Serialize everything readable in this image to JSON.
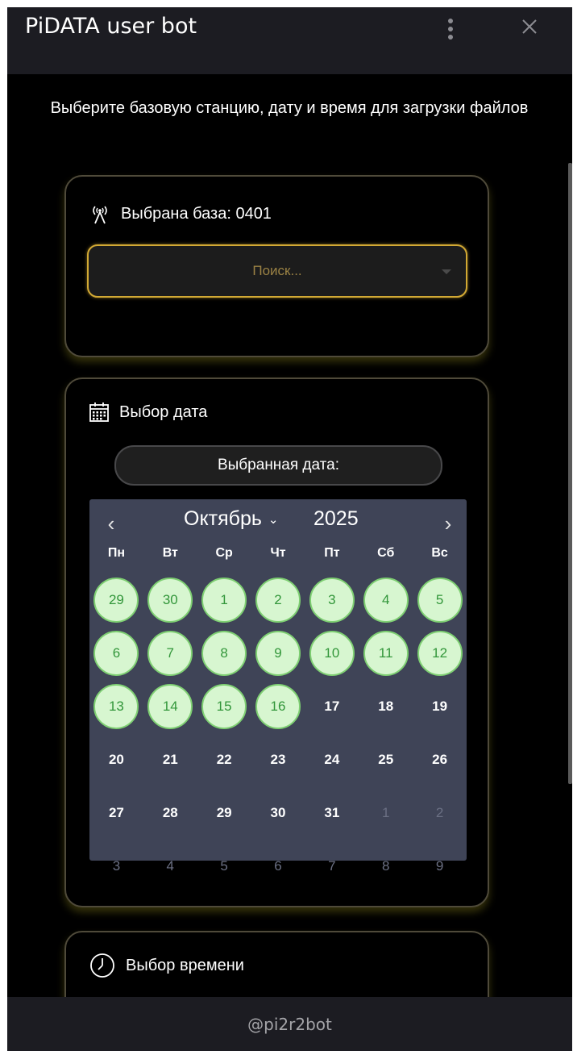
{
  "window": {
    "title": "PiDATA user bot"
  },
  "intro_text": "Выберите базовую станцию, дату и время для загрузки файлов",
  "base_card": {
    "heading": "Выбрана база: 0401",
    "search": {
      "placeholder": "Поиск..."
    }
  },
  "date_card": {
    "heading": "Выбор дата",
    "selected_date_label": "Выбранная дата:",
    "calendar": {
      "month": "Октябрь",
      "year": "2025",
      "weekdays": [
        "Пн",
        "Вт",
        "Ср",
        "Чт",
        "Пт",
        "Сб",
        "Вс"
      ],
      "days": [
        {
          "label": "29",
          "state": "available"
        },
        {
          "label": "30",
          "state": "available"
        },
        {
          "label": "1",
          "state": "available"
        },
        {
          "label": "2",
          "state": "available"
        },
        {
          "label": "3",
          "state": "available"
        },
        {
          "label": "4",
          "state": "available"
        },
        {
          "label": "5",
          "state": "available"
        },
        {
          "label": "6",
          "state": "available"
        },
        {
          "label": "7",
          "state": "available"
        },
        {
          "label": "8",
          "state": "available"
        },
        {
          "label": "9",
          "state": "available"
        },
        {
          "label": "10",
          "state": "available"
        },
        {
          "label": "11",
          "state": "available"
        },
        {
          "label": "12",
          "state": "available"
        },
        {
          "label": "13",
          "state": "available"
        },
        {
          "label": "14",
          "state": "available"
        },
        {
          "label": "15",
          "state": "available"
        },
        {
          "label": "16",
          "state": "available"
        },
        {
          "label": "17",
          "state": "normal"
        },
        {
          "label": "18",
          "state": "normal"
        },
        {
          "label": "19",
          "state": "normal"
        },
        {
          "label": "20",
          "state": "normal"
        },
        {
          "label": "21",
          "state": "normal"
        },
        {
          "label": "22",
          "state": "normal"
        },
        {
          "label": "23",
          "state": "normal"
        },
        {
          "label": "24",
          "state": "normal"
        },
        {
          "label": "25",
          "state": "normal"
        },
        {
          "label": "26",
          "state": "normal"
        },
        {
          "label": "27",
          "state": "normal"
        },
        {
          "label": "28",
          "state": "normal"
        },
        {
          "label": "29",
          "state": "normal"
        },
        {
          "label": "30",
          "state": "normal"
        },
        {
          "label": "31",
          "state": "normal"
        },
        {
          "label": "1",
          "state": "muted"
        },
        {
          "label": "2",
          "state": "muted"
        },
        {
          "label": "3",
          "state": "muted"
        },
        {
          "label": "4",
          "state": "muted"
        },
        {
          "label": "5",
          "state": "muted"
        },
        {
          "label": "6",
          "state": "muted"
        },
        {
          "label": "7",
          "state": "muted"
        },
        {
          "label": "8",
          "state": "muted"
        },
        {
          "label": "9",
          "state": "muted"
        }
      ]
    }
  },
  "time_card": {
    "heading": "Выбор времени"
  },
  "footer": {
    "bot_handle": "@pi2r2bot"
  },
  "colors": {
    "background": "#000000",
    "accent_gold": "#d2a934",
    "calendar_bg": "#3f4457",
    "available_day_fill": "#d7f6d0",
    "available_day_text": "#32963a"
  }
}
